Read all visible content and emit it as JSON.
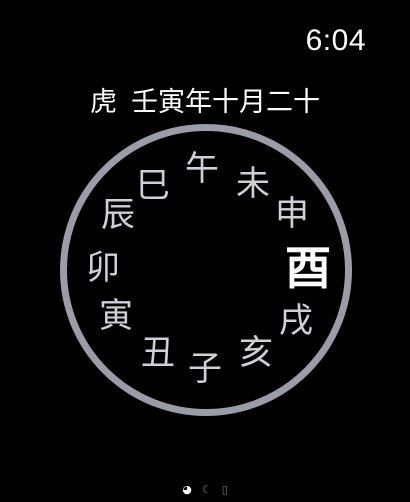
{
  "status": {
    "time": "6:04"
  },
  "lunar": {
    "zodiac": "虎",
    "date": "壬寅年十月二十"
  },
  "dial": {
    "ring_color": "#9a9da8",
    "current_branch": "酉",
    "branches": {
      "si": "巳",
      "wu": "午",
      "wei": "未",
      "shen": "申",
      "you": "酉",
      "xu": "戌",
      "hai": "亥",
      "zi": "子",
      "chou": "丑",
      "yin": "寅",
      "mao": "卯",
      "chen": "辰"
    }
  },
  "pages": {
    "icons": [
      "clock-face-icon",
      "moon-icon",
      "book-icon"
    ],
    "active_index": 0
  }
}
